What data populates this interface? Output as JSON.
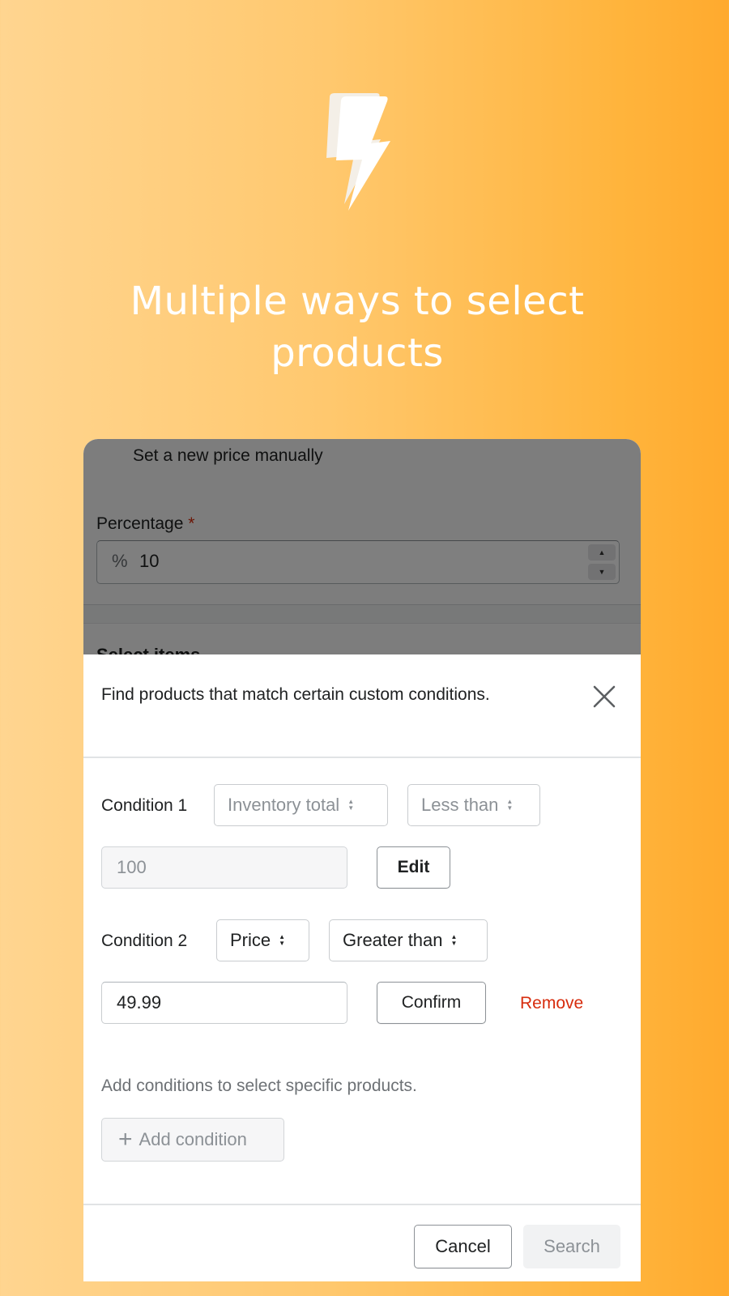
{
  "hero": {
    "icon": "lightning-bolt-icon",
    "title_line1": "Multiple ways to select",
    "title_line2": "products"
  },
  "background_page": {
    "manual_option_label": "Set a new price manually",
    "percentage_label": "Percentage",
    "required_marker": "*",
    "percentage_prefix": "%",
    "percentage_value": "10",
    "section_title": "Select items"
  },
  "modal": {
    "description": "Find products that match certain custom conditions.",
    "close_icon": "close-icon",
    "conditions": [
      {
        "label": "Condition 1",
        "field": "Inventory total",
        "operator": "Less than",
        "value": "100",
        "action_label": "Edit",
        "editable": false
      },
      {
        "label": "Condition 2",
        "field": "Price",
        "operator": "Greater than",
        "value": "49.99",
        "action_label": "Confirm",
        "remove_label": "Remove",
        "editable": true
      }
    ],
    "hint": "Add conditions to select specific products.",
    "add_condition_label": "Add condition",
    "footer": {
      "cancel_label": "Cancel",
      "search_label": "Search"
    }
  },
  "colors": {
    "gradient_start": "#ffd590",
    "gradient_end": "#ffaa2e",
    "critical": "#d72c0d",
    "text": "#202223",
    "subdued": "#6d7175"
  }
}
